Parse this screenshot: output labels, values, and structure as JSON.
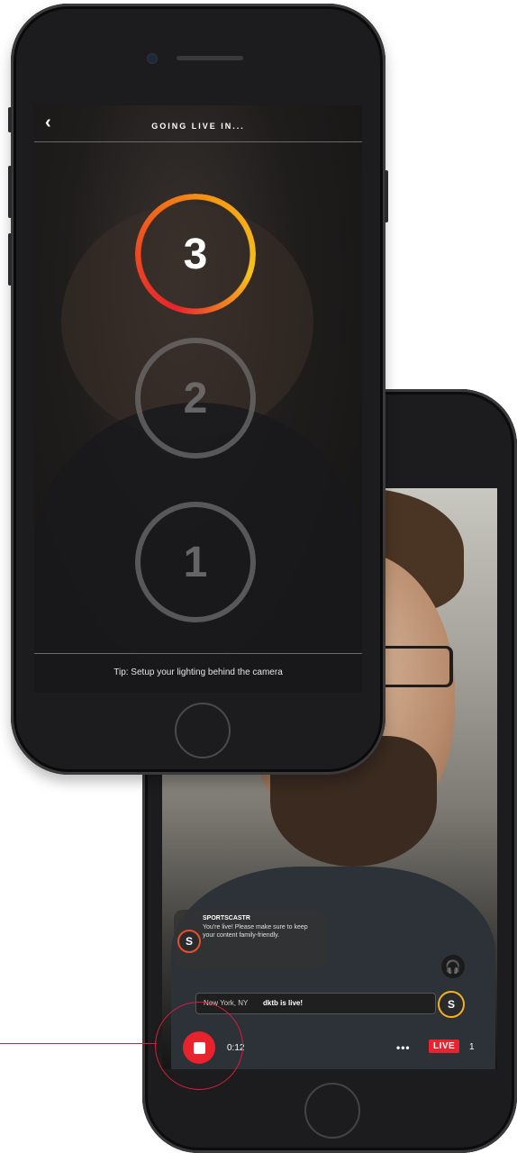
{
  "countdown_screen": {
    "title": "GOING LIVE IN...",
    "back_icon": "chevron-left-icon",
    "countdown": [
      "3",
      "2",
      "1"
    ],
    "active_number": "3",
    "tip": "Tip: Setup your lighting behind the camera",
    "ring_colors": [
      "#e8232e",
      "#f59a12",
      "#f7c31a"
    ]
  },
  "live_screen": {
    "chat": {
      "sender": "SPORTSCASTR",
      "message": "You're live! Please make sure to keep your content family-friendly.",
      "logo_letter": "S"
    },
    "ticker": {
      "location": "New York, NY",
      "message": "dktb is live!",
      "avatar_letter": "S"
    },
    "headphone_icon": "headphones-icon",
    "timer": "0:12",
    "more_label": "•••",
    "live_label": "LIVE",
    "viewers": "1",
    "accent_color": "#e8232e"
  }
}
